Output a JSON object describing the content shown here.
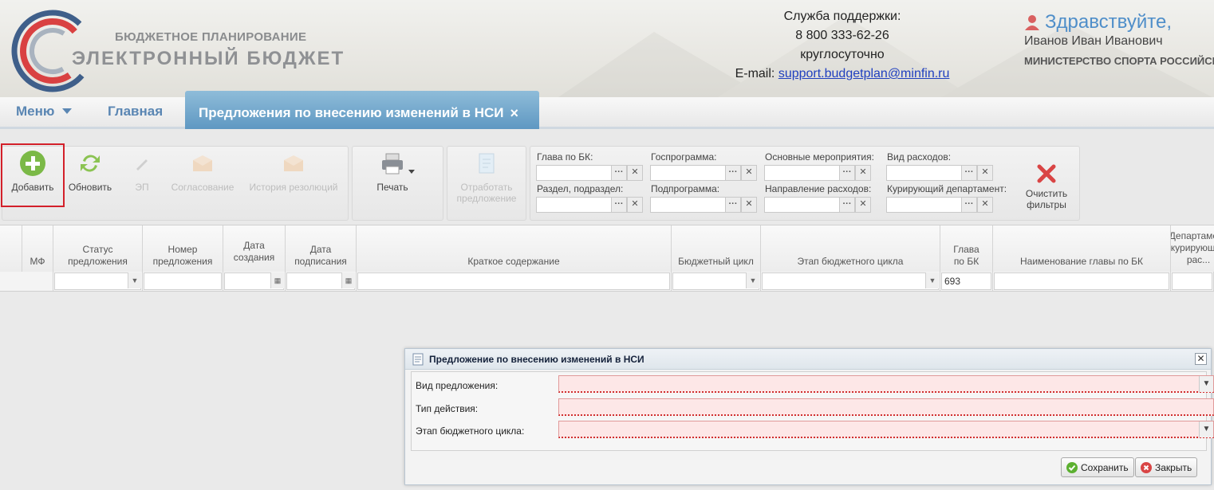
{
  "header": {
    "brand_top": "БЮДЖЕТНОЕ ПЛАНИРОВАНИЕ",
    "brand_main": "ЭЛЕКТРОННЫЙ БЮДЖЕТ",
    "support_title": "Служба поддержки:",
    "support_phone": "8 800 333-62-26",
    "support_hours": "круглосуточно",
    "email_label": "E-mail:",
    "email": "support.budgetplan@minfin.ru",
    "greeting": "Здравствуйте,",
    "user_name": "Иванов Иван Иванович",
    "organization": "МИНИСТЕРСТВО СПОРТА РОССИЙСКОЙ"
  },
  "tabs": {
    "menu": "Меню",
    "home": "Главная",
    "active": "Предложения по внесению изменений в НСИ"
  },
  "toolbar": {
    "add": "Добавить",
    "refresh": "Обновить",
    "signature": "ЭП",
    "approval": "Согласование",
    "history": "История резолюций",
    "print": "Печать",
    "process_l1": "Отработать",
    "process_l2": "предложение",
    "clear_l1": "Очистить",
    "clear_l2": "фильтры"
  },
  "filters": {
    "chapter": "Глава по БК:",
    "program": "Госпрограмма:",
    "main_events": "Основные мероприятия:",
    "expense_type": "Вид расходов:",
    "section": "Раздел, подраздел:",
    "subprogram": "Подпрограмма:",
    "expense_direction": "Направление расходов:",
    "department": "Курирующий департамент:"
  },
  "grid": {
    "columns": [
      "МФ",
      "Статус предложения",
      "Номер предложения",
      "Дата создания",
      "Дата подписания",
      "Краткое содержание",
      "Бюджетный цикл",
      "Этап бюджетного цикла",
      "Глава по БК",
      "Наименование главы по БК",
      "Департамент курирующий рас..."
    ],
    "chapter_filter_value": "693"
  },
  "dialog": {
    "title": "Предложение по внесению изменений в НСИ",
    "field_type": "Вид предложения:",
    "field_action": "Тип действия:",
    "field_stage": "Этап бюджетного цикла:",
    "save": "Сохранить",
    "close": "Закрыть"
  },
  "colors": {
    "accent": "#5f98c2",
    "highlight": "#d3202a",
    "required_bg": "#fde7e7"
  }
}
